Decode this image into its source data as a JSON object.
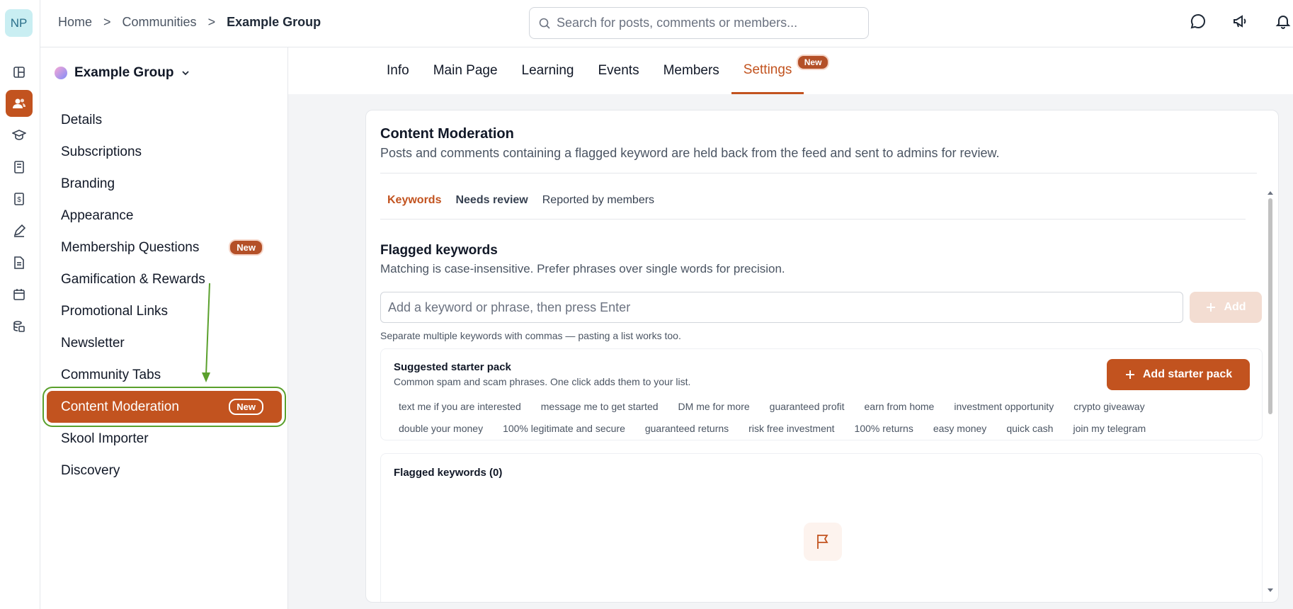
{
  "rail": {
    "avatar_initials": "NP",
    "icons": [
      "layout-icon",
      "community-icon",
      "graduation-cap-icon",
      "book-icon",
      "dollar-document-icon",
      "pen-icon",
      "document-icon",
      "calendar-icon",
      "database-icon"
    ]
  },
  "breadcrumb": {
    "home": "Home",
    "sep1": ">",
    "communities": "Communities",
    "sep2": ">",
    "current": "Example Group"
  },
  "search": {
    "placeholder": "Search for posts, comments or members..."
  },
  "sidebar": {
    "group_name": "Example Group",
    "items": [
      {
        "label": "Details"
      },
      {
        "label": "Subscriptions"
      },
      {
        "label": "Branding"
      },
      {
        "label": "Appearance"
      },
      {
        "label": "Membership Questions",
        "badge": "New"
      },
      {
        "label": "Gamification & Rewards"
      },
      {
        "label": "Promotional Links"
      },
      {
        "label": "Newsletter"
      },
      {
        "label": "Community Tabs"
      },
      {
        "label": "Content Moderation",
        "badge": "New"
      },
      {
        "label": "Skool Importer"
      },
      {
        "label": "Discovery"
      }
    ]
  },
  "tabs": {
    "info": "Info",
    "main_page": "Main Page",
    "learning": "Learning",
    "events": "Events",
    "members": "Members",
    "settings": "Settings",
    "settings_badge": "New"
  },
  "content": {
    "title": "Content Moderation",
    "subtitle": "Posts and comments containing a flagged keyword are held back from the feed and sent to admins for review.",
    "subtabs": {
      "keywords": "Keywords",
      "needs_review": "Needs review",
      "reported": "Reported by members"
    },
    "flagged_title": "Flagged keywords",
    "flagged_sub": "Matching is case-insensitive. Prefer phrases over single words for precision.",
    "input_placeholder": "Add a keyword or phrase, then press Enter",
    "add_label": "Add",
    "hint": "Separate multiple keywords with commas — pasting a list works too.",
    "pack": {
      "title": "Suggested starter pack",
      "subtitle": "Common spam and scam phrases. One click adds them to your list.",
      "button": "Add starter pack",
      "chips": [
        "text me if you are interested",
        "message me to get started",
        "DM me for more",
        "guaranteed profit",
        "earn from home",
        "investment opportunity",
        "crypto giveaway",
        "double your money",
        "100% legitimate and secure",
        "guaranteed returns",
        "risk free investment",
        "100% returns",
        "easy money",
        "quick cash",
        "join my telegram"
      ]
    },
    "list_title": "Flagged keywords (0)"
  },
  "colors": {
    "accent": "#c2531f",
    "highlight_outline": "#5aa02c"
  }
}
